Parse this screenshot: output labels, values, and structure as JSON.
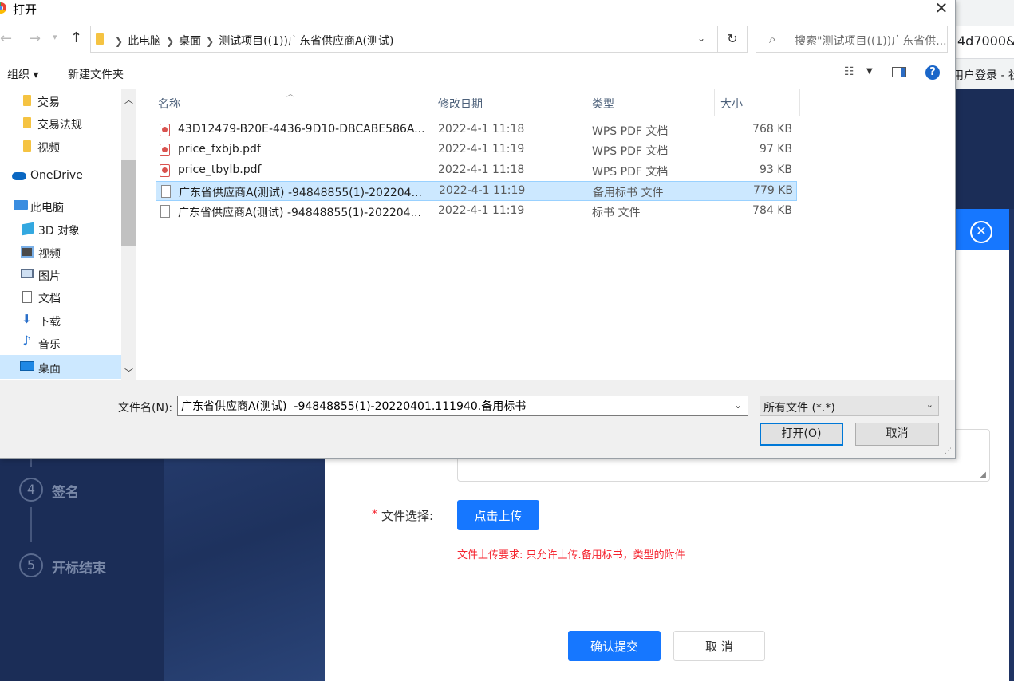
{
  "background": {
    "url_fragment": "4d7000&",
    "tab_fragment": "用户登录 - 社",
    "steps": [
      {
        "num": "4",
        "label": "签名"
      },
      {
        "num": "5",
        "label": "开标结束"
      }
    ],
    "modal_close_glyph": "✕",
    "form": {
      "required_mark": "*",
      "file_label": "文件选择:",
      "upload_button": "点击上传",
      "upload_hint": "文件上传要求:  只允许上传.备用标书，类型的附件",
      "confirm_button": "确认提交",
      "cancel_button": "取 消"
    }
  },
  "dialog": {
    "title": "打开",
    "close_glyph": "✕",
    "breadcrumbs": [
      "此电脑",
      "桌面",
      "测试项目((1))广东省供应商A(测试)"
    ],
    "search_placeholder": "搜索\"测试项目((1))广东省供...",
    "toolbar": {
      "organize": "组织 ▾",
      "new_folder": "新建文件夹",
      "help": "?"
    },
    "nav_items": [
      {
        "label": "交易",
        "icon": "folder-icon"
      },
      {
        "label": "交易法规",
        "icon": "folder-icon"
      },
      {
        "label": "视频",
        "icon": "folder-icon"
      },
      {
        "label": "OneDrive",
        "icon": "cloud-icon"
      },
      {
        "label": "此电脑",
        "icon": "computer-icon"
      },
      {
        "label": "3D 对象",
        "icon": "cube-icon"
      },
      {
        "label": "视频",
        "icon": "video-icon"
      },
      {
        "label": "图片",
        "icon": "picture-icon"
      },
      {
        "label": "文档",
        "icon": "document-icon"
      },
      {
        "label": "下载",
        "icon": "download-icon"
      },
      {
        "label": "音乐",
        "icon": "music-icon"
      },
      {
        "label": "桌面",
        "icon": "desktop-icon"
      }
    ],
    "columns": {
      "name": "名称",
      "date": "修改日期",
      "type": "类型",
      "size": "大小"
    },
    "files": [
      {
        "name": "43D12479-B20E-4436-9D10-DBCABE586A...",
        "date": "2022-4-1 11:18",
        "type": "WPS PDF 文档",
        "size": "768 KB",
        "icon": "pdf-file-icon"
      },
      {
        "name": "price_fxbjb.pdf",
        "date": "2022-4-1 11:19",
        "type": "WPS PDF 文档",
        "size": "97 KB",
        "icon": "pdf-file-icon"
      },
      {
        "name": "price_tbylb.pdf",
        "date": "2022-4-1 11:18",
        "type": "WPS PDF 文档",
        "size": "93 KB",
        "icon": "pdf-file-icon"
      },
      {
        "name": "广东省供应商A(测试)  -94848855(1)-202204...",
        "date": "2022-4-1 11:19",
        "type": "备用标书 文件",
        "size": "779 KB",
        "icon": "blank-file-icon",
        "selected": true
      },
      {
        "name": "广东省供应商A(测试)  -94848855(1)-202204...",
        "date": "2022-4-1 11:19",
        "type": "标书 文件",
        "size": "784 KB",
        "icon": "blank-file-icon"
      }
    ],
    "filename_label": "文件名(N):",
    "filename_value": "广东省供应商A(测试)  -94848855(1)-20220401.111940.备用标书",
    "filetype_value": "所有文件 (*.*)",
    "open_button": "打开(O)",
    "cancel_button": "取消"
  },
  "colors": {
    "accent": "#1677ff",
    "selection": "#cce8ff",
    "dark_bg": "#1b2d57",
    "error": "#f5222d"
  }
}
